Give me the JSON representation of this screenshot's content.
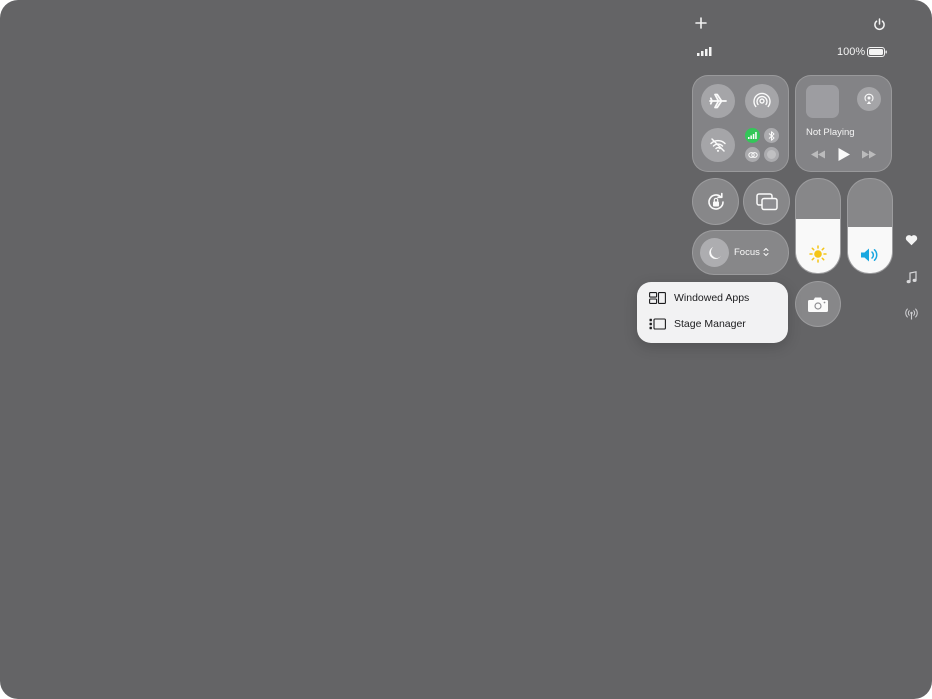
{
  "top_bar": {
    "add_icon": "plus-icon",
    "power_icon": "power-icon"
  },
  "status": {
    "battery_text": "100%",
    "signal_icon": "cellular-signal-icon",
    "battery_icon": "battery-full-icon"
  },
  "connectivity": {
    "airplane_icon": "airplane-icon",
    "airdrop_icon": "airdrop-icon",
    "wifi_icon": "wifi-off-icon",
    "cellular_icon": "cellular-data-icon",
    "bluetooth_icon": "bluetooth-icon",
    "hotspot_icon": "personal-hotspot-icon",
    "extra_icon": "focus-dot-icon"
  },
  "now_playing": {
    "label": "Not Playing",
    "airplay_icon": "airplay-audio-icon",
    "prev_icon": "rewind-icon",
    "play_icon": "play-icon",
    "next_icon": "fast-forward-icon"
  },
  "controls": {
    "rotation_lock_icon": "rotation-lock-icon",
    "screen_mirroring_icon": "screen-mirroring-icon",
    "focus_label": "Focus",
    "focus_icon": "moon-icon",
    "camera_icon": "camera-icon"
  },
  "brightness": {
    "level": 0.57,
    "icon": "sun-icon",
    "icon_color": "#f5c518"
  },
  "volume": {
    "level": 0.49,
    "icon": "speaker-icon",
    "icon_color": "#1aa7e0"
  },
  "stage_menu": {
    "items": [
      {
        "label": "Windowed Apps",
        "icon": "windowed-apps-icon"
      },
      {
        "label": "Stage Manager",
        "icon": "stage-manager-icon"
      }
    ]
  },
  "side_controls": {
    "heart_icon": "heart-icon",
    "music_icon": "music-note-icon",
    "antenna_icon": "antenna-icon"
  },
  "colors": {
    "background": "#646466",
    "cellular_active": "#34c759"
  }
}
